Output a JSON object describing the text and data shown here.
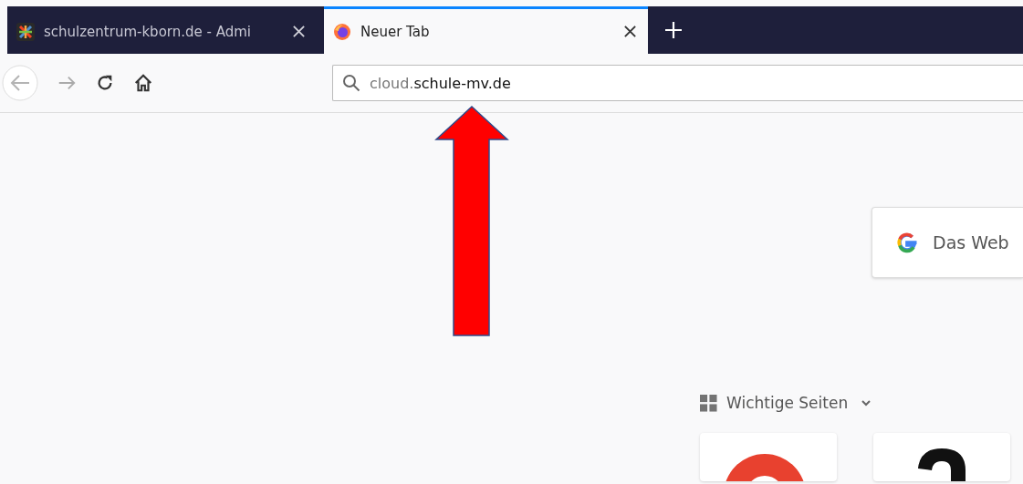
{
  "tabs": [
    {
      "title": "schulzentrum-kborn.de - Admi",
      "selected": false
    },
    {
      "title": "Neuer Tab",
      "selected": true
    }
  ],
  "toolbar": {
    "url": {
      "prefix": "cloud.",
      "domain": "schule-mv.de"
    }
  },
  "annotation": {
    "kind": "arrow-up",
    "color": "#ff0000"
  },
  "search": {
    "placeholder": "Das Web"
  },
  "top_sites": {
    "title": "Wichtige Seiten",
    "expanded": true,
    "tiles": [
      {
        "kind": "ring",
        "color": "#e8412f"
      },
      {
        "kind": "arch",
        "color": "#111111"
      }
    ]
  }
}
